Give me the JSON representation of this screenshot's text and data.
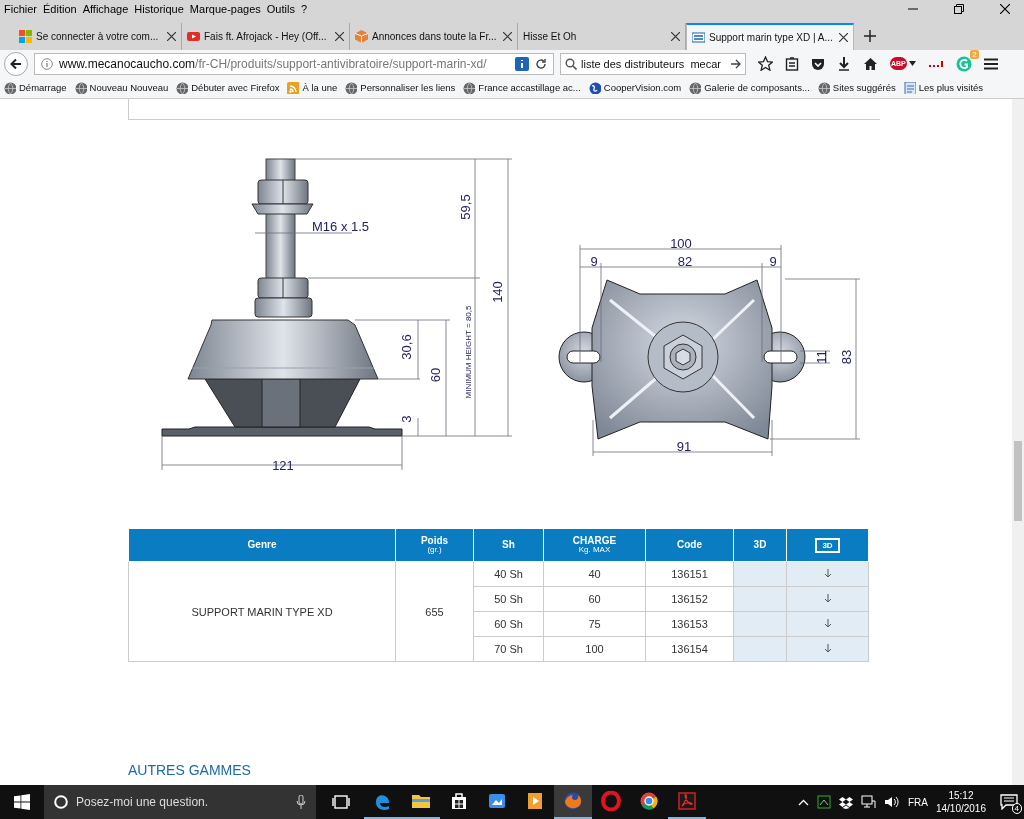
{
  "menu_bar": [
    "Fichier",
    "Édition",
    "Affichage",
    "Historique",
    "Marque-pages",
    "Outils",
    "?"
  ],
  "tabs": [
    {
      "title": "Se connecter à votre com...",
      "kind": "windows",
      "selected": false
    },
    {
      "title": "Fais ft. Afrojack - Hey (Off...",
      "kind": "video",
      "selected": false
    },
    {
      "title": "Annonces dans toute la Fr...",
      "kind": "box",
      "selected": false
    },
    {
      "title": "Hisse Et Oh",
      "kind": "plain",
      "selected": false
    },
    {
      "title": "Support marin type XD | A...",
      "kind": "site",
      "selected": true
    }
  ],
  "address_bar": {
    "host": "www.mecanocaucho.com",
    "path": "/fr-CH/produits/support-antivibratoire/support-marin-xd/"
  },
  "search": {
    "value": "liste des distributeurs  mecar"
  },
  "toolbar": {
    "adblock_label": "ABP",
    "extension_badge": "2"
  },
  "bookmarks": [
    {
      "label": "Démarrage",
      "kind": "globe"
    },
    {
      "label": "Nouveau Nouveau",
      "kind": "globe"
    },
    {
      "label": "Débuter avec Firefox",
      "kind": "globe"
    },
    {
      "label": "À la une",
      "kind": "feed"
    },
    {
      "label": "Personnaliser les liens",
      "kind": "globe"
    },
    {
      "label": "France accastillage ac...",
      "kind": "globe"
    },
    {
      "label": "CooperVision.com",
      "kind": "earth"
    },
    {
      "label": "Galerie de composants...",
      "kind": "globe"
    },
    {
      "label": "Sites suggérés",
      "kind": "globe"
    },
    {
      "label": "Les plus visités",
      "kind": "page"
    }
  ],
  "drawing": {
    "side_view_dimensions": [
      "59,5",
      "140",
      "M16 x 1.5",
      "MINIMUM HEIGHT = 80,5",
      "30,6",
      "60",
      "3",
      "121"
    ],
    "top_view_dimensions": [
      "100",
      "9",
      "82",
      "9",
      "11",
      "83",
      "91"
    ]
  },
  "table": {
    "columns": [
      {
        "label": "Genre",
        "kind": "plain"
      },
      {
        "label": "Poids",
        "sublabel": "(gr.)",
        "kind": "plain"
      },
      {
        "label": "Sh",
        "kind": "plain"
      },
      {
        "label": "CHARGE",
        "sublabel": "Kg. MAX",
        "kind": "plain"
      },
      {
        "label": "Code",
        "kind": "plain"
      },
      {
        "label": "3D",
        "kind": "plain"
      },
      {
        "label": "3D",
        "kind": "boxed"
      }
    ],
    "product": {
      "genre": "SUPPORT MARIN TYPE XD",
      "poids": "655"
    },
    "rows": [
      {
        "sh": "40 Sh",
        "charge": "40",
        "code": "136151"
      },
      {
        "sh": "50 Sh",
        "charge": "60",
        "code": "136152"
      },
      {
        "sh": "60 Sh",
        "charge": "75",
        "code": "136153"
      },
      {
        "sh": "70 Sh",
        "charge": "100",
        "code": "136154"
      }
    ]
  },
  "section_heading": "AUTRES GAMMES",
  "taskbar": {
    "search_placeholder": "Posez-moi une question.",
    "apps": [
      {
        "kind": "edge",
        "running": true,
        "selected": false
      },
      {
        "kind": "folder",
        "running": true,
        "selected": false
      },
      {
        "kind": "store",
        "running": false,
        "selected": false
      },
      {
        "kind": "photos",
        "running": false,
        "selected": false
      },
      {
        "kind": "media",
        "running": false,
        "selected": false
      },
      {
        "kind": "firefox",
        "running": true,
        "selected": true
      },
      {
        "kind": "opera",
        "running": false,
        "selected": false
      },
      {
        "kind": "chrome",
        "running": false,
        "selected": false
      },
      {
        "kind": "pdf",
        "running": true,
        "selected": false
      }
    ],
    "language": "FRA",
    "time": "15:12",
    "date": "14/10/2016",
    "notifications": "4"
  }
}
